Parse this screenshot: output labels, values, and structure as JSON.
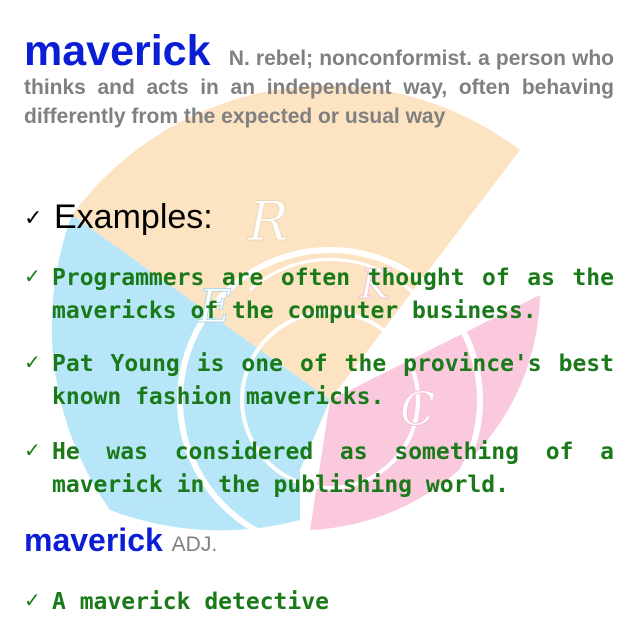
{
  "entry": {
    "headword": "maverick",
    "pos": "N.",
    "definition": "rebel; nonconformist. a person who thinks and acts in an independent way, often behaving differently from the expected or usual way"
  },
  "examples_heading": "Examples:",
  "examples": [
    "Programmers are often thought of as the mavericks of the computer business.",
    "Pat Young is one of the province's best known fashion mavericks.",
    "He was considered as something of a maverick in the publishing world."
  ],
  "entry2": {
    "headword": "maverick",
    "pos": "ADJ."
  },
  "examples2": [
    "A maverick detective"
  ],
  "icons": {
    "bullet": "checkmark-icon"
  },
  "watermark": {
    "letters": [
      "R",
      "E",
      "K",
      "C"
    ],
    "colors": {
      "orange": "#f9c27a",
      "blue": "#5fc8f0",
      "pink": "#f58ab4"
    }
  },
  "colors": {
    "headword": "#0a1ed6",
    "definition": "#808080",
    "example": "#1a7a1a",
    "heading": "#000000"
  }
}
